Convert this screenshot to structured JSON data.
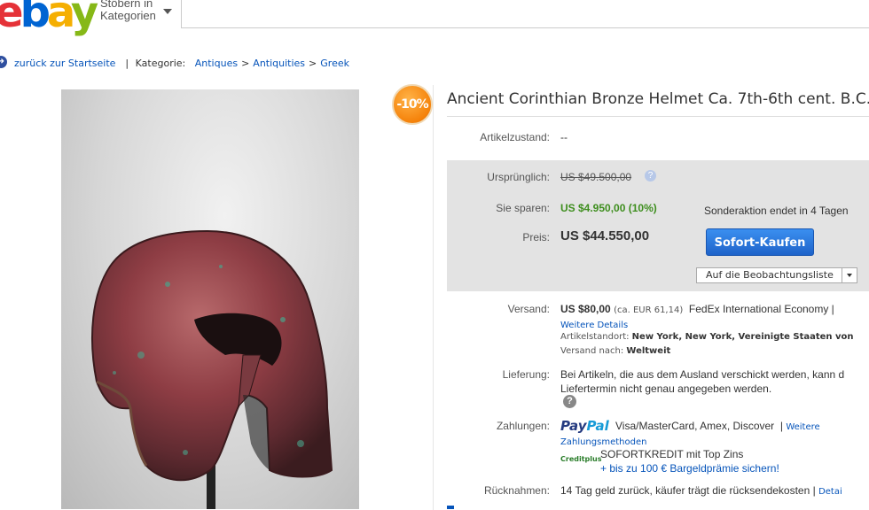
{
  "header": {
    "logo": {
      "l1": "e",
      "l2": "b",
      "l3": "a",
      "l4": "y"
    },
    "browse_line1": "Stöbern in",
    "browse_line2": "Kategorien"
  },
  "breadcrumb": {
    "back": "zurück zur Startseite",
    "category_label": "Kategorie:",
    "items": [
      "Antiques",
      "Antiquities",
      "Greek"
    ],
    "separator": ">"
  },
  "badge": {
    "discount": "-10%"
  },
  "item": {
    "title": "Ancient Corinthian Bronze Helmet Ca. 7th-6th cent. B.C.",
    "condition_label": "Artikelzustand:",
    "condition_value": "--"
  },
  "pricing": {
    "original_label": "Ursprünglich:",
    "original_value": "US $49.500,00",
    "save_label": "Sie sparen:",
    "save_value": "US $4.950,00 (10%)",
    "price_label": "Preis:",
    "price_value": "US $44.550,00",
    "promo_text": "Sonderaktion endet in 4 Tagen",
    "buy_button": "Sofort-Kaufen",
    "watch_button": "Auf die Beobachtungsliste"
  },
  "shipping": {
    "label": "Versand:",
    "price": "US $80,00",
    "converted": "(ca. EUR 61,14)",
    "service": "FedEx International Economy |",
    "more_link": "Weitere Details",
    "location_label": "Artikelstandort:",
    "location_value": "New York, New York, Vereinigte Staaten von",
    "ships_to_label": "Versand nach:",
    "ships_to_value": "Weltweit"
  },
  "delivery": {
    "label": "Lieferung:",
    "line1": "Bei Artikeln, die aus dem Ausland verschickt werden, kann d",
    "line2": "Liefertermin nicht genau angegeben werden.",
    "help": "?"
  },
  "payment": {
    "label": "Zahlungen:",
    "paypal1": "Pay",
    "paypal2": "Pal",
    "methods": "Visa/MasterCard, Amex, Discover",
    "sep": "|",
    "more_link1": "Weitere",
    "more_link2": "Zahlungsmethoden",
    "creditplus": "Creditplus",
    "sofortkredit": "SOFORTKREDIT mit Top Zins",
    "bonus_link": "+ bis zu 100 € Bargeldprämie sichern!"
  },
  "returns": {
    "label": "Rücknahmen:",
    "text": "14 Tag geld zurück, käufer trägt die rücksendekosten |",
    "details_link": "Detai"
  },
  "colors": {
    "link": "#0654ba",
    "save_green": "#3e8e1e",
    "buy_blue": "#1f63c9",
    "price_bg": "#e3e3e3"
  }
}
